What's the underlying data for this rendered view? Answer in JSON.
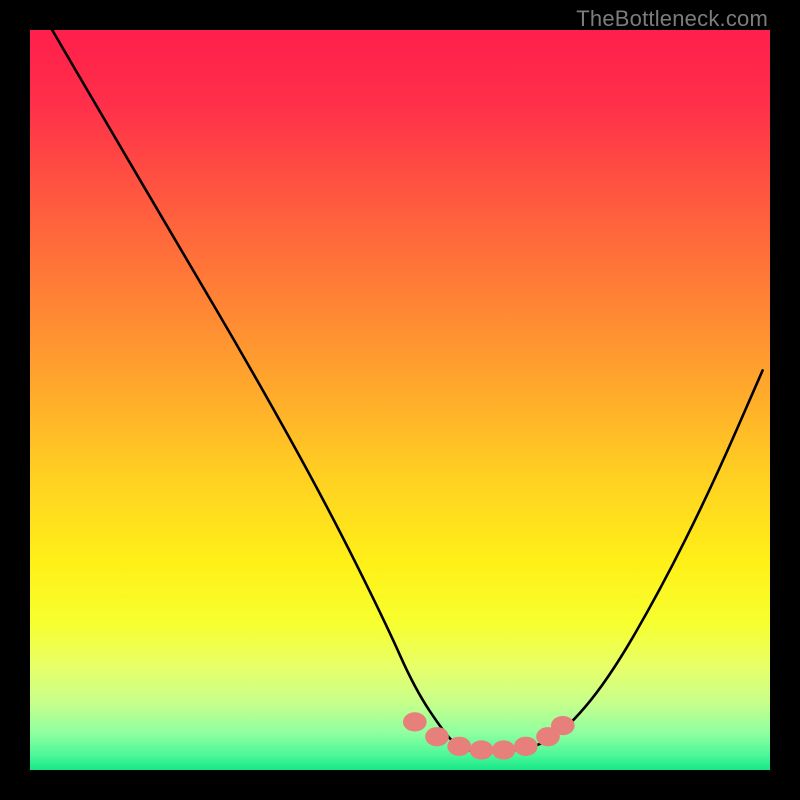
{
  "watermark": "TheBottleneck.com",
  "gradient_stops": [
    {
      "offset": 0.0,
      "color": "#ff1f4b"
    },
    {
      "offset": 0.1,
      "color": "#ff2f4a"
    },
    {
      "offset": 0.22,
      "color": "#ff5640"
    },
    {
      "offset": 0.35,
      "color": "#ff7e36"
    },
    {
      "offset": 0.48,
      "color": "#ffa72c"
    },
    {
      "offset": 0.6,
      "color": "#ffcf22"
    },
    {
      "offset": 0.72,
      "color": "#fff018"
    },
    {
      "offset": 0.8,
      "color": "#f7ff2e"
    },
    {
      "offset": 0.86,
      "color": "#e8ff68"
    },
    {
      "offset": 0.91,
      "color": "#c6ff8c"
    },
    {
      "offset": 0.95,
      "color": "#8fffa0"
    },
    {
      "offset": 0.98,
      "color": "#4cf79a"
    },
    {
      "offset": 1.0,
      "color": "#17e887"
    }
  ],
  "chart_data": {
    "type": "line",
    "title": "",
    "xlabel": "",
    "ylabel": "",
    "xlim": [
      0,
      100
    ],
    "ylim": [
      0,
      100
    ],
    "series": [
      {
        "name": "curve",
        "color": "#000000",
        "x": [
          3,
          10,
          20,
          30,
          40,
          48,
          52,
          56,
          58,
          60,
          64,
          68,
          72,
          78,
          85,
          92,
          99
        ],
        "y": [
          100,
          88,
          71,
          54,
          36,
          20,
          11,
          5,
          3,
          2.5,
          2.5,
          3,
          5,
          12,
          24,
          38,
          54
        ]
      }
    ],
    "highlight_dots": {
      "color": "#e77f7a",
      "points": [
        {
          "x": 52,
          "y": 6.5
        },
        {
          "x": 55,
          "y": 4.5
        },
        {
          "x": 58,
          "y": 3.2
        },
        {
          "x": 61,
          "y": 2.7
        },
        {
          "x": 64,
          "y": 2.7
        },
        {
          "x": 67,
          "y": 3.2
        },
        {
          "x": 70,
          "y": 4.5
        },
        {
          "x": 72,
          "y": 6.0
        }
      ]
    }
  }
}
